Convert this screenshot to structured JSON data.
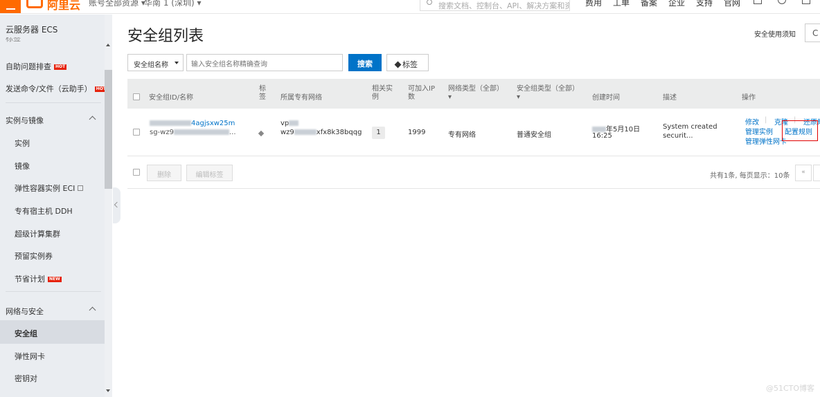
{
  "topbar": {
    "logo": "阿里云",
    "account_link": "账号全部资源 ▾",
    "region": "华南 1 (深圳) ▾",
    "search_placeholder": "搜索文档、控制台、API、解决方案和资源",
    "nav": [
      "费用",
      "工单",
      "备案",
      "企业",
      "支持",
      "官网"
    ],
    "icons": [
      "terminal-icon",
      "bell-icon",
      "cart-icon"
    ]
  },
  "sidebar": {
    "title": "云服务器 ECS",
    "cut_label": "标签",
    "items": {
      "troubleshoot": "自助问题排查",
      "commands": "发送命令/文件（云助手）",
      "instances_group": "实例与镜像",
      "instances": "实例",
      "images": "镜像",
      "eci": "弹性容器实例 ECI",
      "ddh": "专有宿主机 DDH",
      "supercomputing": "超级计算集群",
      "reserved": "预留实例券",
      "savings": "节省计划",
      "network_group": "网络与安全",
      "security_group": "安全组",
      "eni": "弹性网卡",
      "keypair": "密钥对"
    },
    "badges": {
      "hot": "HOT",
      "new": "NEW"
    }
  },
  "main": {
    "title": "安全组列表",
    "help": "安全使用须知",
    "refresh": "C",
    "filter": {
      "select_label": "安全组名称",
      "input_placeholder": "输入安全组名称精确查询",
      "search_label": "搜索",
      "tag_label": "标签"
    },
    "columns": {
      "id": "安全组ID/名称",
      "tag_l1": "标",
      "tag_l2": "签",
      "vpc": "所属专有网络",
      "related_l1": "相关实",
      "related_l2": "例",
      "joinable_l1": "可加入IP",
      "joinable_l2": "数",
      "net_type": "网络类型（全部）",
      "sg_type": "安全组类型（全部）",
      "created": "创建时间",
      "desc": "描述",
      "ops": "操作"
    },
    "row": {
      "name": "4agjsxw25m",
      "id": "sg-wz9",
      "id_tail": "...",
      "vpc_top": "vp",
      "vpc_id": "xfx8k38bqqg",
      "vpc_prefix": "wz9",
      "related": "1",
      "joinable": "1999",
      "net_type": "专有网络",
      "sg_type": "普通安全组",
      "created_l1": "年5月10日",
      "created_l2": "16:25",
      "desc_l1": "System created",
      "desc_l2": "securit...",
      "ops": {
        "modify": "修改",
        "clone": "克隆",
        "restore": "还原规则",
        "manage_instances": "管理实例",
        "config_rules": "配置规则",
        "manage_eni": "管理弹性网卡"
      }
    },
    "footer": {
      "delete": "删除",
      "edit_tags": "编辑标签",
      "pager_text": "共有1条, 每页显示：10条",
      "prev": "«"
    }
  },
  "watermark": "@51CTO博客"
}
